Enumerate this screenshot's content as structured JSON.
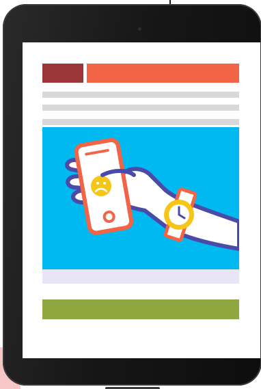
{
  "scene": {
    "device": "tablet",
    "icons": [
      "smartphone-icon",
      "sad-face-icon",
      "smartwatch-icon",
      "clock-icon"
    ]
  },
  "colors": {
    "bezel": "#171717",
    "screen": "#ffffff",
    "header_block_dark": "#9b3538",
    "header_block": "#f26446",
    "text_line_placeholder": "#d9d9d9",
    "hero_background": "#00b9f0",
    "hand_outline": "#4a4aa8",
    "phone_outline": "#f26446",
    "watch_outline": "#f26446",
    "face_yellow": "#f5c518",
    "caption_strip": "#e8e6f6",
    "button_green": "#8ea83f"
  }
}
